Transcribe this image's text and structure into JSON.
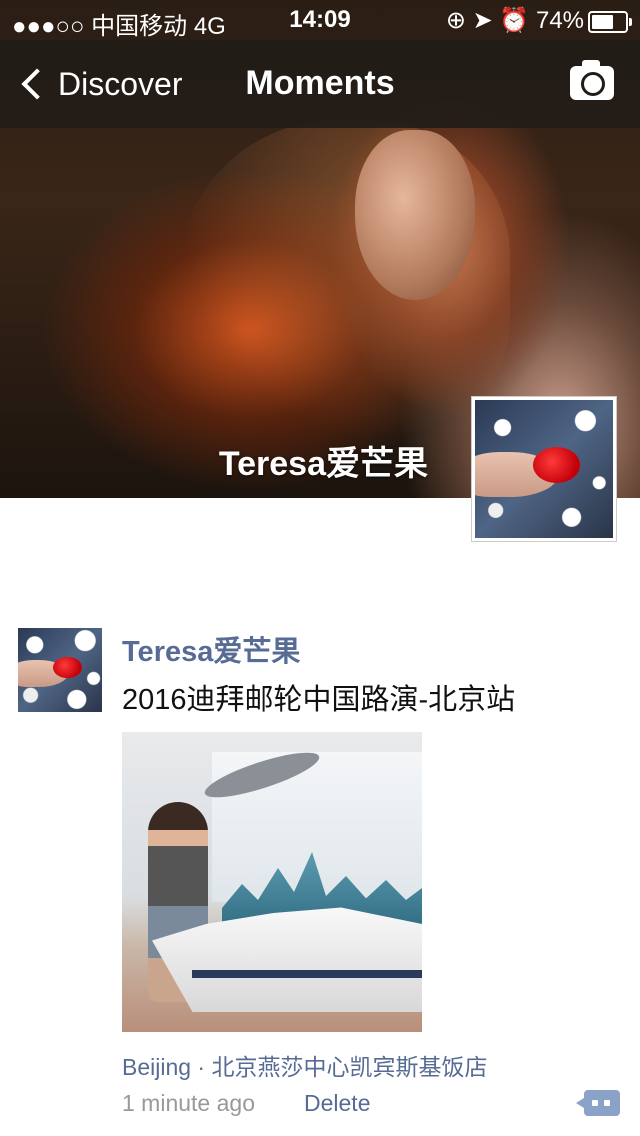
{
  "status_bar": {
    "carrier": "●●●○○ 中国移动  4G",
    "time": "14:09",
    "indicators": "⊕ ➤ ⏰ 74%",
    "battery_percent": 74
  },
  "nav": {
    "back_label": "Discover",
    "title": "Moments",
    "camera_icon": "camera-icon"
  },
  "cover": {
    "user_name": "Teresa爱芒果"
  },
  "post": {
    "author": "Teresa爱芒果",
    "text": "2016迪拜邮轮中国路演-北京站",
    "location": "Beijing · 北京燕莎中心凯宾斯基饭店",
    "time_ago": "1 minute ago",
    "delete_label": "Delete",
    "comment_icon": "comment-icon"
  },
  "colors": {
    "link": "#576b95",
    "nav_bg": "#221c18",
    "meta": "#999999"
  }
}
